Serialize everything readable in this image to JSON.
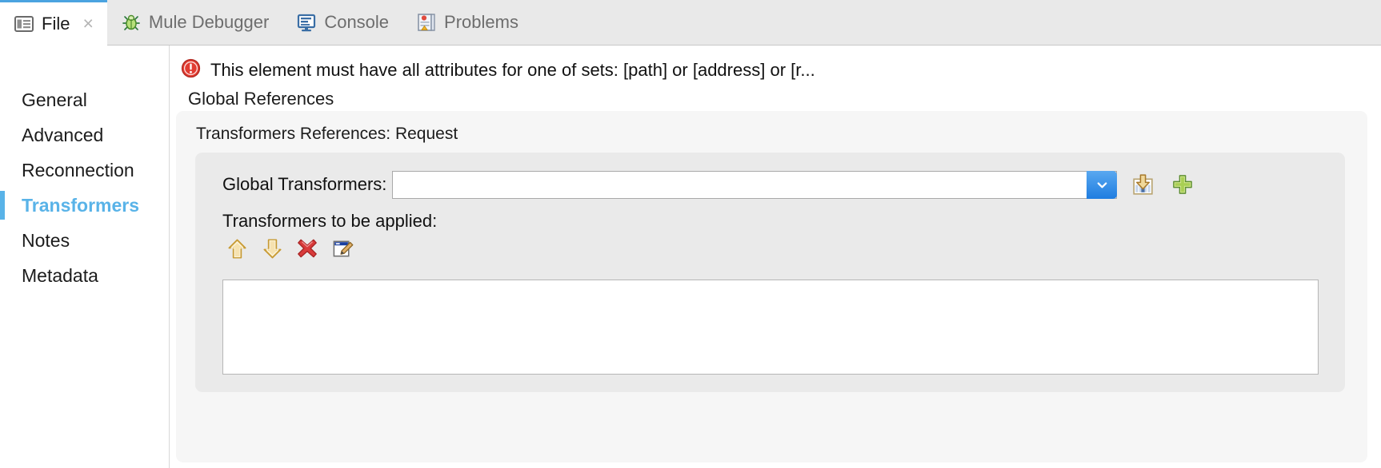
{
  "tabs": [
    {
      "label": "File",
      "icon": "file-window-icon",
      "active": true,
      "closable": true
    },
    {
      "label": "Mule Debugger",
      "icon": "bug-icon",
      "active": false,
      "closable": false
    },
    {
      "label": "Console",
      "icon": "monitor-icon",
      "active": false,
      "closable": false
    },
    {
      "label": "Problems",
      "icon": "problems-report-icon",
      "active": false,
      "closable": false
    }
  ],
  "tab_close_glyph": "×",
  "validation": {
    "icon": "error-icon",
    "message": "This element must have all attributes for one of sets: [path] or [address] or [r..."
  },
  "sidebar": {
    "items": [
      {
        "label": "General",
        "selected": false
      },
      {
        "label": "Advanced",
        "selected": false
      },
      {
        "label": "Reconnection",
        "selected": false
      },
      {
        "label": "Transformers",
        "selected": true
      },
      {
        "label": "Notes",
        "selected": false
      },
      {
        "label": "Metadata",
        "selected": false
      }
    ]
  },
  "main": {
    "section_label": "Global References",
    "group_title": "Transformers References: Request",
    "global_transformers": {
      "label": "Global Transformers:",
      "value": "",
      "placeholder": "",
      "dropdown_icon": "chevron-down-icon",
      "actions": [
        {
          "name": "import-into-document-icon",
          "title": ""
        },
        {
          "name": "add-plus-icon",
          "title": ""
        }
      ]
    },
    "applied": {
      "label": "Transformers to be applied:",
      "toolbar": [
        {
          "name": "move-up-icon"
        },
        {
          "name": "move-down-icon"
        },
        {
          "name": "delete-x-icon"
        },
        {
          "name": "edit-pencil-icon"
        }
      ],
      "list_items": []
    }
  },
  "colors": {
    "accent_blue": "#59b3e8",
    "dropdown_blue": "#1f7de0",
    "error_red": "#e23c32",
    "plus_green": "#8cc152",
    "arrow_gold": "#d9a441",
    "delete_red": "#d93b3b",
    "tabbar_bg": "#e9e9e9",
    "panel_bg": "#eaeaea",
    "outer_panel_bg": "#f6f6f6"
  }
}
